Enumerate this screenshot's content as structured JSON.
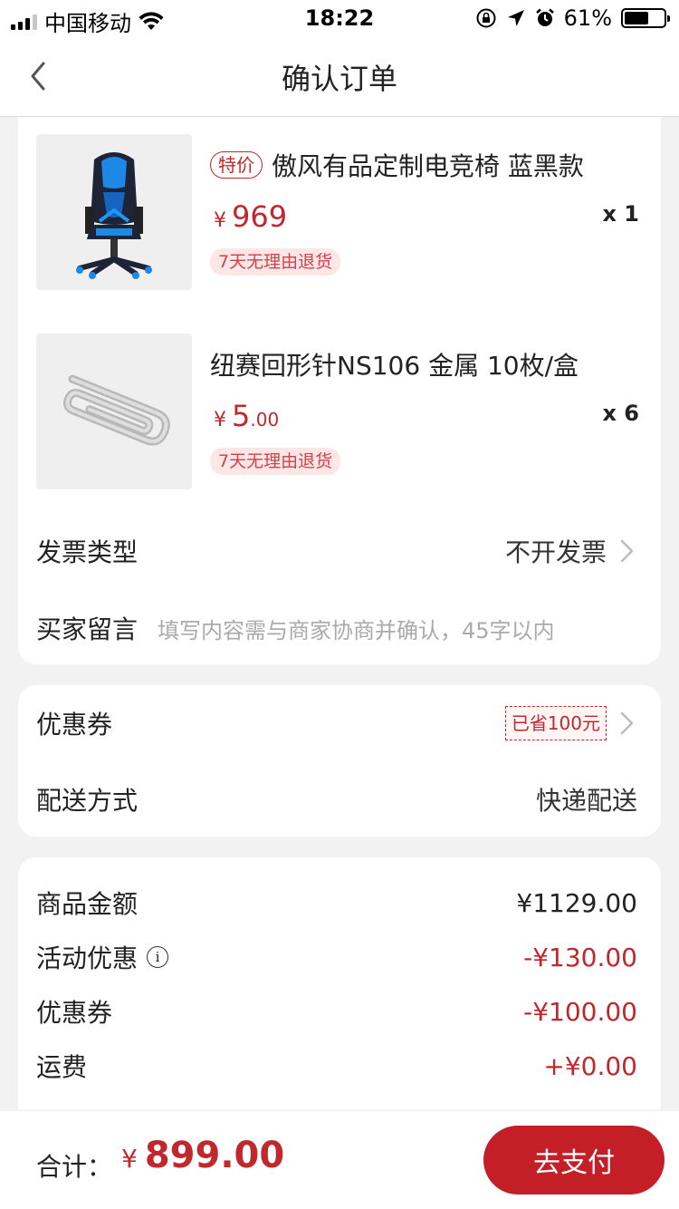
{
  "status_bar": {
    "carrier": "中国移动",
    "time": "18:22",
    "battery": "61%",
    "battery_level": 0.61
  },
  "nav": {
    "title": "确认订单"
  },
  "products": [
    {
      "tag": "特价",
      "title": "傲风有品定制电竞椅 蓝黑款",
      "currency": "¥",
      "price_int": "969",
      "price_dec": "",
      "qty": "x 1",
      "return_policy": "7天无理由退货",
      "icon": "gaming-chair-image"
    },
    {
      "tag": "",
      "title": "纽赛回形针NS106 金属 10枚/盒",
      "currency": "¥",
      "price_int": "5",
      "price_dec": ".00",
      "qty": "x 6",
      "return_policy": "7天无理由退货",
      "icon": "paper-clip-image"
    }
  ],
  "invoice": {
    "label": "发票类型",
    "value": "不开发票"
  },
  "message": {
    "label": "买家留言",
    "placeholder": "填写内容需与商家协商并确认，45字以内"
  },
  "coupon": {
    "label": "优惠券",
    "badge": "已省100元"
  },
  "delivery": {
    "label": "配送方式",
    "value": "快递配送"
  },
  "summary": {
    "items": [
      {
        "label": "商品金额",
        "value": "¥1129.00",
        "info": false,
        "negative": false
      },
      {
        "label": "活动优惠",
        "value": "-¥130.00",
        "info": true,
        "negative": true
      },
      {
        "label": "优惠券",
        "value": "-¥100.00",
        "info": false,
        "negative": true
      },
      {
        "label": "运费",
        "value": "+¥0.00",
        "info": false,
        "negative": true
      }
    ]
  },
  "footer": {
    "total_label": "合计：",
    "currency": "¥",
    "total": "899.00",
    "pay_label": "去支付"
  },
  "colors": {
    "accent": "#c0282d",
    "pay_button": "#c41e26",
    "background": "#f2f2f2"
  }
}
